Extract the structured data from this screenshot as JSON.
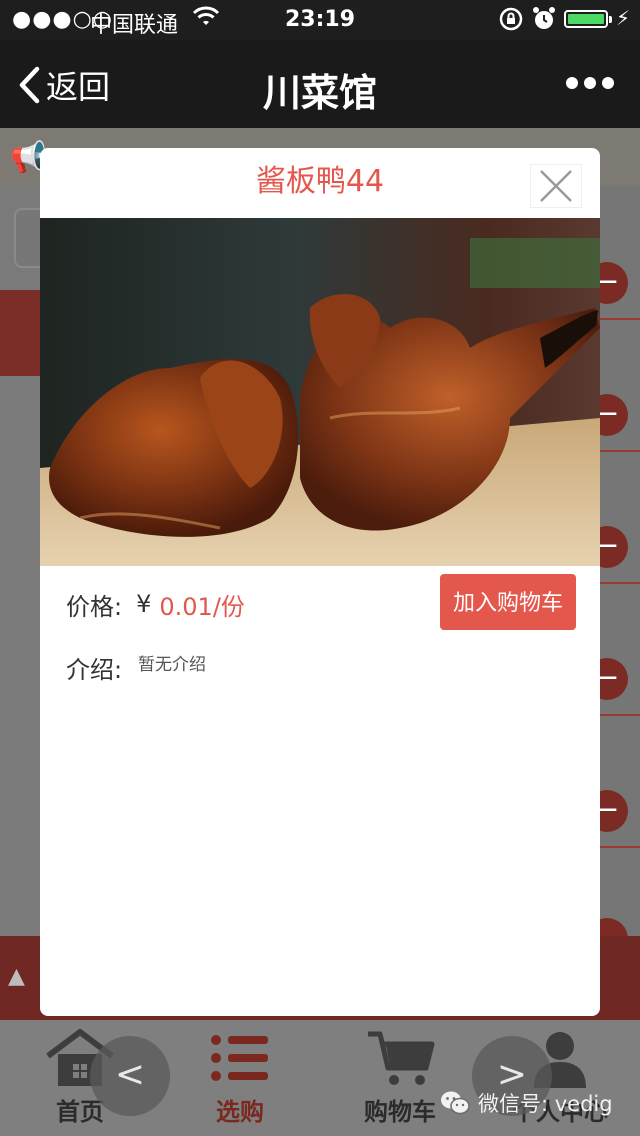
{
  "status_bar": {
    "signal": "●●●○○",
    "carrier": "中国联通",
    "time": "23:19"
  },
  "navbar": {
    "back_label": "返回",
    "title": "川菜馆"
  },
  "modal": {
    "dish_name": "酱板鸭44",
    "photo_alt": "",
    "price_label": "价格:",
    "currency": "¥",
    "price_value": "0.01/份",
    "add_to_cart_label": "加入购物车",
    "intro_label": "介绍:",
    "intro_text": "暂无介绍"
  },
  "tabbar": {
    "tabs": [
      {
        "label": "首页",
        "icon": "home-icon"
      },
      {
        "label": "选购",
        "icon": "list-icon",
        "active": true
      },
      {
        "label": "购物车",
        "icon": "cart-icon"
      },
      {
        "label": "个人中心",
        "icon": "user-icon"
      }
    ]
  },
  "watermark": "微信号: vedig",
  "colors": {
    "accent": "#e4574c",
    "nav_bg": "#1a1a1a",
    "battery": "#4cd964"
  }
}
